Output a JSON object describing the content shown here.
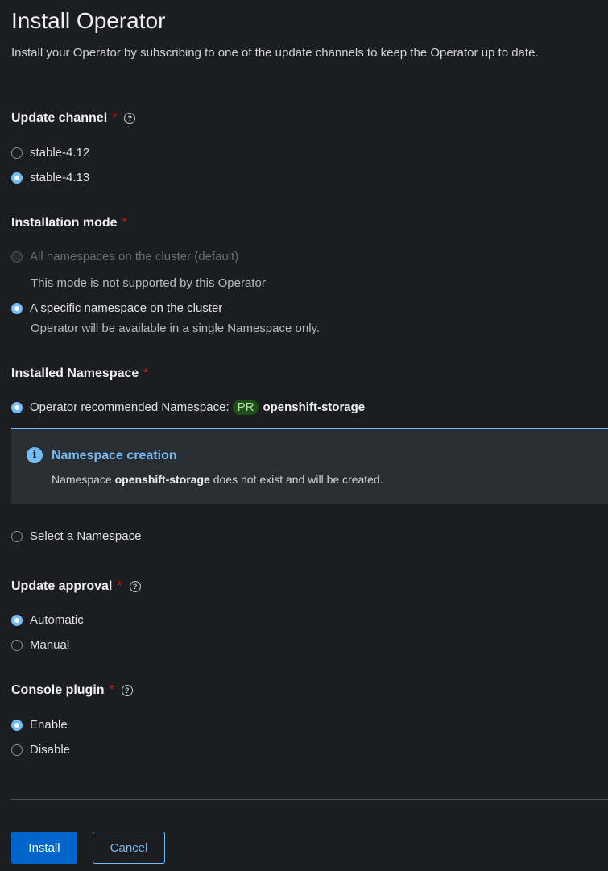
{
  "header": {
    "title": "Install Operator",
    "subtitle": "Install your Operator by subscribing to one of the update channels to keep the Operator up to date."
  },
  "update_channel": {
    "label": "Update channel",
    "required_mark": "*",
    "options": [
      {
        "label": "stable-4.12",
        "checked": false
      },
      {
        "label": "stable-4.13",
        "checked": true
      }
    ]
  },
  "installation_mode": {
    "label": "Installation mode",
    "required_mark": "*",
    "options": [
      {
        "label": "All namespaces on the cluster (default)",
        "checked": false,
        "disabled": true,
        "helper": "This mode is not supported by this Operator"
      },
      {
        "label": "A specific namespace on the cluster",
        "checked": true,
        "disabled": false,
        "helper": "Operator will be available in a single Namespace only."
      }
    ]
  },
  "installed_namespace": {
    "label": "Installed Namespace",
    "required_mark": "*",
    "recommended_label": "Operator recommended Namespace:",
    "badge": "PR",
    "namespace": "openshift-storage",
    "select_label": "Select a Namespace",
    "alert": {
      "title": "Namespace creation",
      "body_prefix": "Namespace",
      "body_namespace": "openshift-storage",
      "body_suffix": "does not exist and will be created."
    }
  },
  "update_approval": {
    "label": "Update approval",
    "required_mark": "*",
    "options": [
      {
        "label": "Automatic",
        "checked": true
      },
      {
        "label": "Manual",
        "checked": false
      }
    ]
  },
  "console_plugin": {
    "label": "Console plugin",
    "required_mark": "*",
    "options": [
      {
        "label": "Enable",
        "checked": true
      },
      {
        "label": "Disable",
        "checked": false
      }
    ]
  },
  "actions": {
    "install_label": "Install",
    "cancel_label": "Cancel"
  },
  "colors": {
    "background": "#1b1d21",
    "accent": "#73bcf7",
    "primary_button": "#0066cc",
    "required": "#c9190b"
  }
}
